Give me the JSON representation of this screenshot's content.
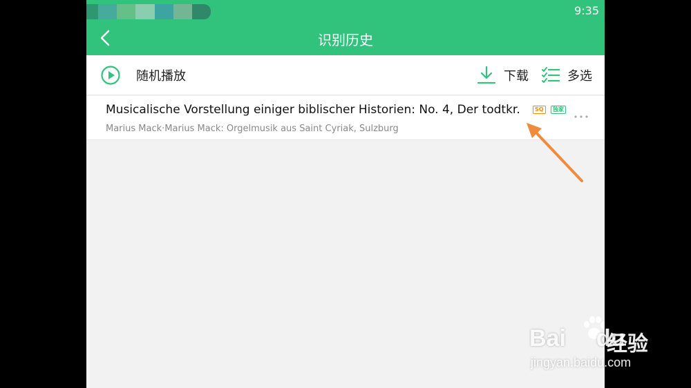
{
  "status_bar": {
    "time": "9:35"
  },
  "header": {
    "title": "识别历史"
  },
  "toolbar": {
    "random_play_label": "随机播放",
    "download_label": "下载",
    "multi_select_label": "多选"
  },
  "list": {
    "items": [
      {
        "title": "Musicalische Vorstellung einiger biblischer Historien: No. 4, Der todtkr.",
        "subtitle": "Marius Mack·Marius Mack: Orgelmusik aus Saint Cyriak, Sulzburg",
        "badges": [
          "SQ",
          "独家"
        ]
      }
    ]
  },
  "watermark": {
    "logo_text_a": "Bai",
    "logo_text_b": "du",
    "logo_cn": "经验",
    "url": "jingyan.baidu.com"
  },
  "colors": {
    "primary_green": "#31c27c",
    "badge_orange": "#ff8a00",
    "annotation_arrow": "#f08a3c"
  },
  "icons": {
    "back": "back-chevron-icon",
    "play": "play-circle-icon",
    "download": "download-icon",
    "multi_select": "checklist-icon",
    "more": "more-dots-icon"
  }
}
